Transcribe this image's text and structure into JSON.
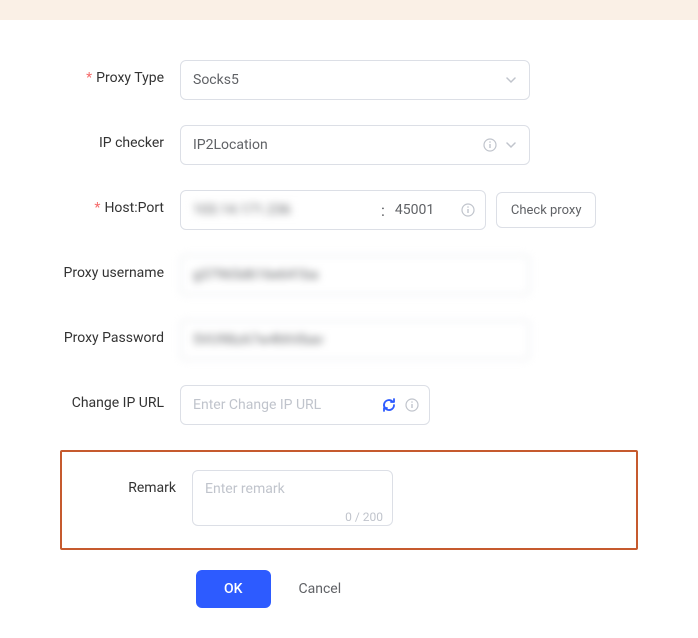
{
  "labels": {
    "proxyType": "Proxy Type",
    "ipChecker": "IP checker",
    "hostPort": "Host:Port",
    "username": "Proxy username",
    "password": "Proxy Password",
    "changeIpUrl": "Change IP URL",
    "remark": "Remark"
  },
  "values": {
    "proxyType": "Socks5",
    "ipChecker": "IP2Location",
    "host": "103.14.171.236",
    "port": "45001",
    "username": "g37965d616e641ba",
    "password": "5VU98zA7w4hhVbav",
    "changeIpUrl": ""
  },
  "placeholders": {
    "changeIpUrl": "Enter Change IP URL",
    "remark": "Enter remark"
  },
  "buttons": {
    "checkProxy": "Check proxy",
    "ok": "OK",
    "cancel": "Cancel"
  },
  "counter": "0 / 200"
}
